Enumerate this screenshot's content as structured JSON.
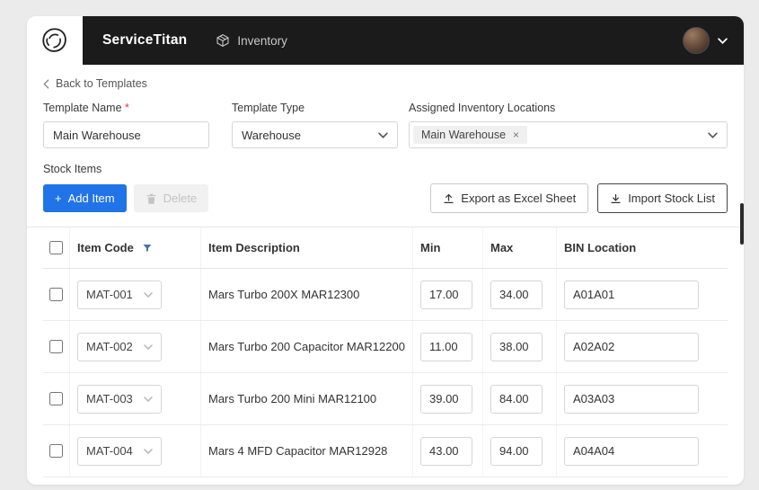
{
  "colors": {
    "accent": "#2173e8",
    "header_bg": "#1b1b1b",
    "required": "#e03b3b"
  },
  "header": {
    "brand": "ServiceTitan",
    "nav": "Inventory"
  },
  "breadcrumb": {
    "back": "Back to Templates"
  },
  "form": {
    "name": {
      "label": "Template Name",
      "required": "*",
      "value": "Main Warehouse"
    },
    "type": {
      "label": "Template Type",
      "value": "Warehouse"
    },
    "locations": {
      "label": "Assigned Inventory Locations",
      "tag": "Main Warehouse",
      "remove": "×"
    }
  },
  "stock": {
    "label": "Stock Items",
    "add_plus": "+",
    "add_label": "Add Item",
    "delete_label": "Delete",
    "export_label": "Export as Excel Sheet",
    "import_label": "Import Stock List"
  },
  "table": {
    "headers": {
      "code": "Item Code",
      "description": "Item Description",
      "min": "Min",
      "max": "Max",
      "bin": "BIN Location"
    },
    "rows": [
      {
        "code": "MAT-001",
        "description": "Mars Turbo 200X MAR12300",
        "min": "17.00",
        "max": "34.00",
        "bin": "A01A01"
      },
      {
        "code": "MAT-002",
        "description": "Mars Turbo 200 Capacitor MAR12200",
        "min": "11.00",
        "max": "38.00",
        "bin": "A02A02"
      },
      {
        "code": "MAT-003",
        "description": "Mars Turbo 200 Mini MAR12100",
        "min": "39.00",
        "max": "84.00",
        "bin": "A03A03"
      },
      {
        "code": "MAT-004",
        "description": "Mars 4 MFD Capacitor MAR12928",
        "min": "43.00",
        "max": "94.00",
        "bin": "A04A04"
      }
    ]
  }
}
